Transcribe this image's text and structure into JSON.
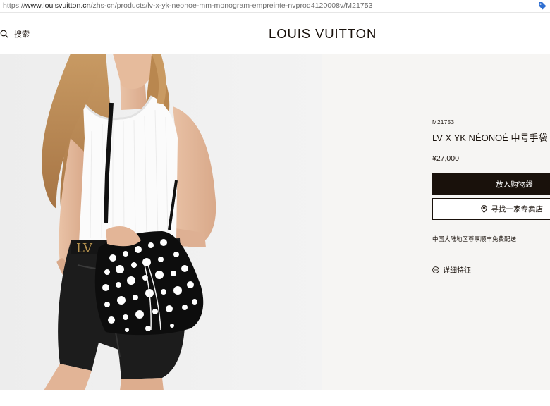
{
  "browser": {
    "url_prefix": "https://",
    "url_domain": "www.louisvuitton.cn",
    "url_path": "/zhs-cn/products/lv-x-yk-neonoe-mm-monogram-empreinte-nvprod4120008v/M21753",
    "extension_icon": "tag-icon",
    "extension_color": "#2f6fd1"
  },
  "header": {
    "search_label": "搜索",
    "search_icon": "search-icon",
    "brand": "LOUIS VUITTON"
  },
  "product": {
    "sku": "M21753",
    "name": "LV X YK NÉONOÉ 中号手袋",
    "price": "¥27,000",
    "add_to_bag": "放入购物袋",
    "find_store": "寻找一家专卖店",
    "find_store_icon": "location-pin-icon",
    "shipping": "中国大陆地区尊享顺丰免费配送",
    "details": "详细特征",
    "details_icon": "more-dots-icon"
  },
  "colors": {
    "brand_dark": "#19110b",
    "panel_bg": "#f6f5f3",
    "hero_bg": "#eeeeee"
  }
}
